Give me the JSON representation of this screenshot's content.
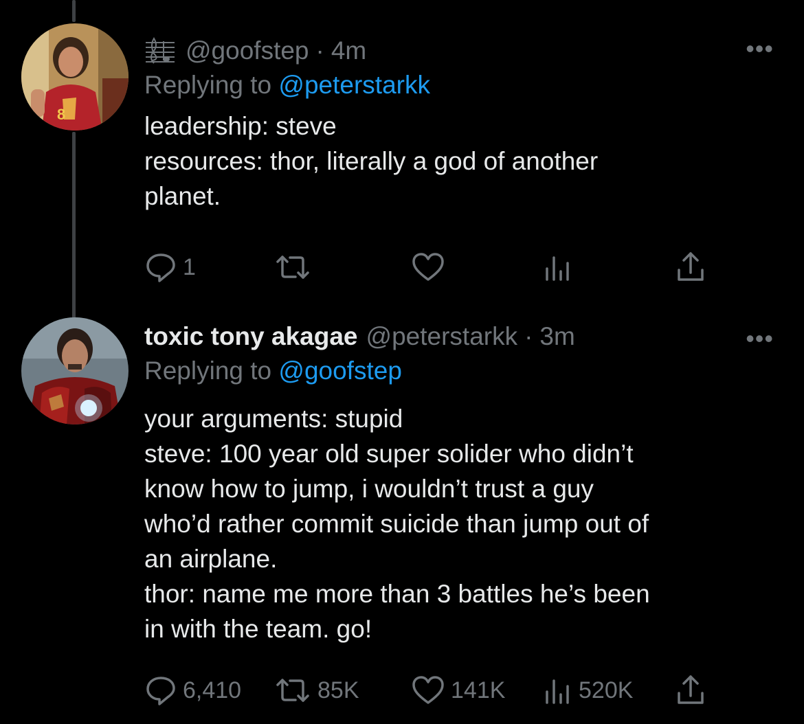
{
  "colors": {
    "background": "#000000",
    "text": "#e7e9ea",
    "muted": "#71767b",
    "link": "#1d9bf0",
    "thread_line": "#3e4144"
  },
  "tweets": [
    {
      "display_name": "",
      "handle": "@goofstep",
      "separator": "·",
      "time": "4m",
      "replying_prefix": "Replying to",
      "replying_to": "@peterstarkk",
      "name_icon": "music-staff-icon",
      "avatar_icon": "person-photo-avatar",
      "lines": [
        "leadership: steve",
        "resources: thor, literally a god of another",
        "planet."
      ],
      "actions": {
        "reply": "1",
        "retweet": "",
        "like": "",
        "views": ""
      }
    },
    {
      "display_name": "toxic tony akagae",
      "handle": "@peterstarkk",
      "separator": "·",
      "time": "3m",
      "replying_prefix": "Replying to",
      "replying_to": "@goofstep",
      "avatar_icon": "iron-man-photo-avatar",
      "lines": [
        "your arguments: stupid",
        "steve: 100 year old super solider who didn’t",
        "know how to jump, i wouldn’t trust a guy",
        "who’d rather commit suicide than jump out of",
        "an airplane.",
        "thor: name me more than 3 battles he’s been",
        "in with the team. go!"
      ],
      "actions": {
        "reply": "6,410",
        "retweet": "85K",
        "like": "141K",
        "views": "520K"
      }
    }
  ],
  "more_label": "•••"
}
